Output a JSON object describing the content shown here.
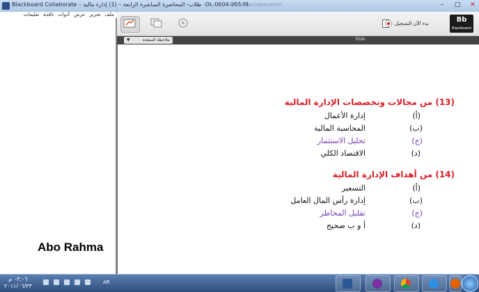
{
  "window": {
    "title": "Blackboard Collaborate – طلاب- المحاضرة المباشرة الرابعة – (1) إدارة مالية -DL-0604-201-M",
    "faded_title": "Windowsiveaveren",
    "controls": [
      "–",
      "□",
      "✕"
    ]
  },
  "menu": {
    "items": [
      "ملف",
      "تحرير",
      "عرض",
      "أدوات",
      "نافذة",
      "تعليمات"
    ]
  },
  "left_pane": {
    "presenter_name": "Abo Rahma"
  },
  "toolbar": {
    "whiteboard_icon": "whiteboard-icon",
    "app_share_icon": "application-share-icon",
    "web_tour_icon": "web-tour-icon",
    "record_label": "بدء الآن التسجيل",
    "logo_text": "Bb",
    "logo_sub": "Blackboard"
  },
  "whiteboard_header": {
    "page_notes_label": "ملاحظة الصفحة",
    "slide_label": "Slide"
  },
  "content": {
    "q13": {
      "heading": "(13) من مجالات وتخصصات الإدارة المالية",
      "items": [
        {
          "marker": "(أ)",
          "text": "إدارة الأعمال",
          "highlight": false
        },
        {
          "marker": "(ب)",
          "text": "المحاسبة المالية",
          "highlight": false
        },
        {
          "marker": "(ج)",
          "text": "تحليل الاستثمار",
          "highlight": true
        },
        {
          "marker": "(د)",
          "text": "الاقتصاد الكلي",
          "highlight": false
        }
      ]
    },
    "q14": {
      "heading": "(14) من أهداف الإدارة المالية",
      "items": [
        {
          "marker": "(أ)",
          "text": "التسعير",
          "highlight": false
        },
        {
          "marker": "(ب)",
          "text": "إدارة رأس المال العامل",
          "highlight": false
        },
        {
          "marker": "(ج)",
          "text": "تقليل المخاطر",
          "highlight": true
        },
        {
          "marker": "(د)",
          "text": "أ و ب صحيح",
          "highlight": false
        }
      ]
    },
    "highlight_color": "#7a3fb3",
    "heading_color": "#d61f26"
  },
  "taskbar": {
    "time": "٠٣:٠٦ م",
    "date": "٢٠١١/٠٦/٣٣",
    "lang": "AR",
    "apps": [
      "word-icon",
      "collaborate-icon",
      "chrome-icon",
      "internet-explorer-icon",
      "firefox-icon"
    ],
    "start_icon": "windows-start-icon"
  }
}
